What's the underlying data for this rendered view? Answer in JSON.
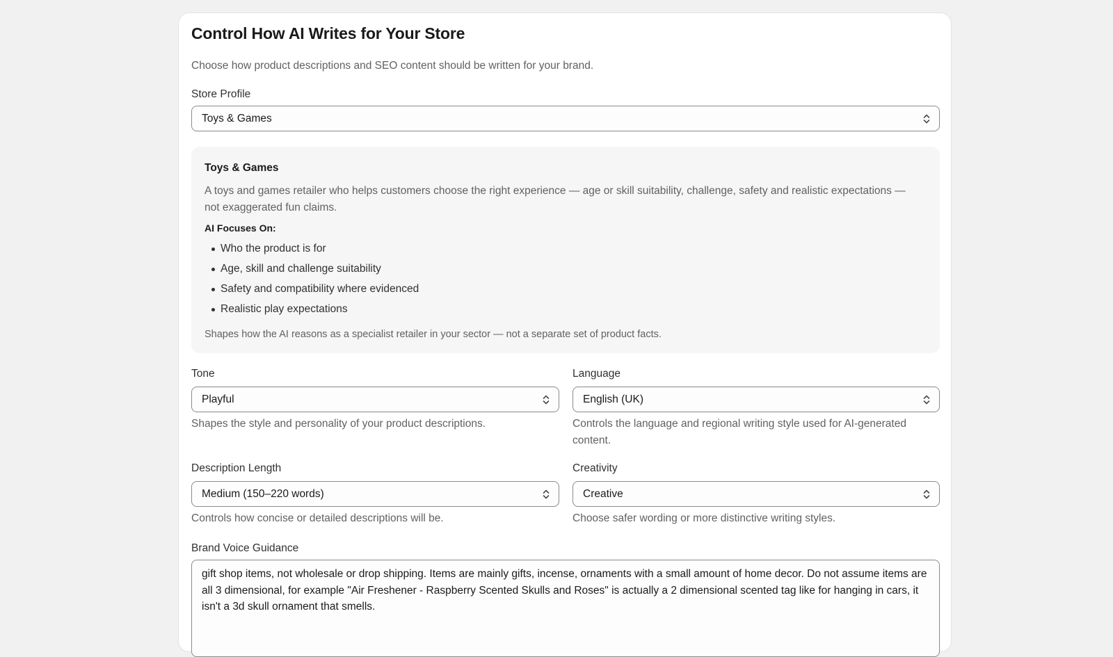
{
  "page": {
    "title": "Control How AI Writes for Your Store",
    "subtitle": "Choose how product descriptions and SEO content should be written for your brand."
  },
  "store_profile": {
    "label": "Store Profile",
    "value": "Toys & Games"
  },
  "profile_card": {
    "name": "Toys & Games",
    "description": "A toys and games retailer who helps customers choose the right experience — age or skill suitability, challenge, safety and realistic expectations — not exaggerated fun claims.",
    "focus_heading": "AI Focuses On:",
    "focus_items": [
      "Who the product is for",
      "Age, skill and challenge suitability",
      "Safety and compatibility where evidenced",
      "Realistic play expectations"
    ],
    "note": "Shapes how the AI reasons as a specialist retailer in your sector — not a separate set of product facts."
  },
  "tone": {
    "label": "Tone",
    "value": "Playful",
    "help": "Shapes the style and personality of your product descriptions."
  },
  "language": {
    "label": "Language",
    "value": "English (UK)",
    "help": "Controls the language and regional writing style used for AI-generated content."
  },
  "description_length": {
    "label": "Description Length",
    "value": "Medium (150–220 words)",
    "help": "Controls how concise or detailed descriptions will be."
  },
  "creativity": {
    "label": "Creativity",
    "value": "Creative",
    "help": "Choose safer wording or more distinctive writing styles."
  },
  "brand_voice": {
    "label": "Brand Voice Guidance",
    "value": "gift shop items, not wholesale or drop shipping. Items are mainly gifts, incense, ornaments with a small amount of home decor. Do not assume items are all 3 dimensional, for example \"Air Freshener - Raspberry Scented Skulls and Roses\" is actually a 2 dimensional scented tag like for hanging in cars, it isn't a 3d skull ornament that smells."
  },
  "icons": {
    "select_chevron": "chevron-up-down-icon"
  },
  "colors": {
    "background": "#f1f1f1",
    "card": "#ffffff",
    "profile_box": "#f6f6f6",
    "border": "#8a8a8a",
    "muted_text": "#616161"
  }
}
